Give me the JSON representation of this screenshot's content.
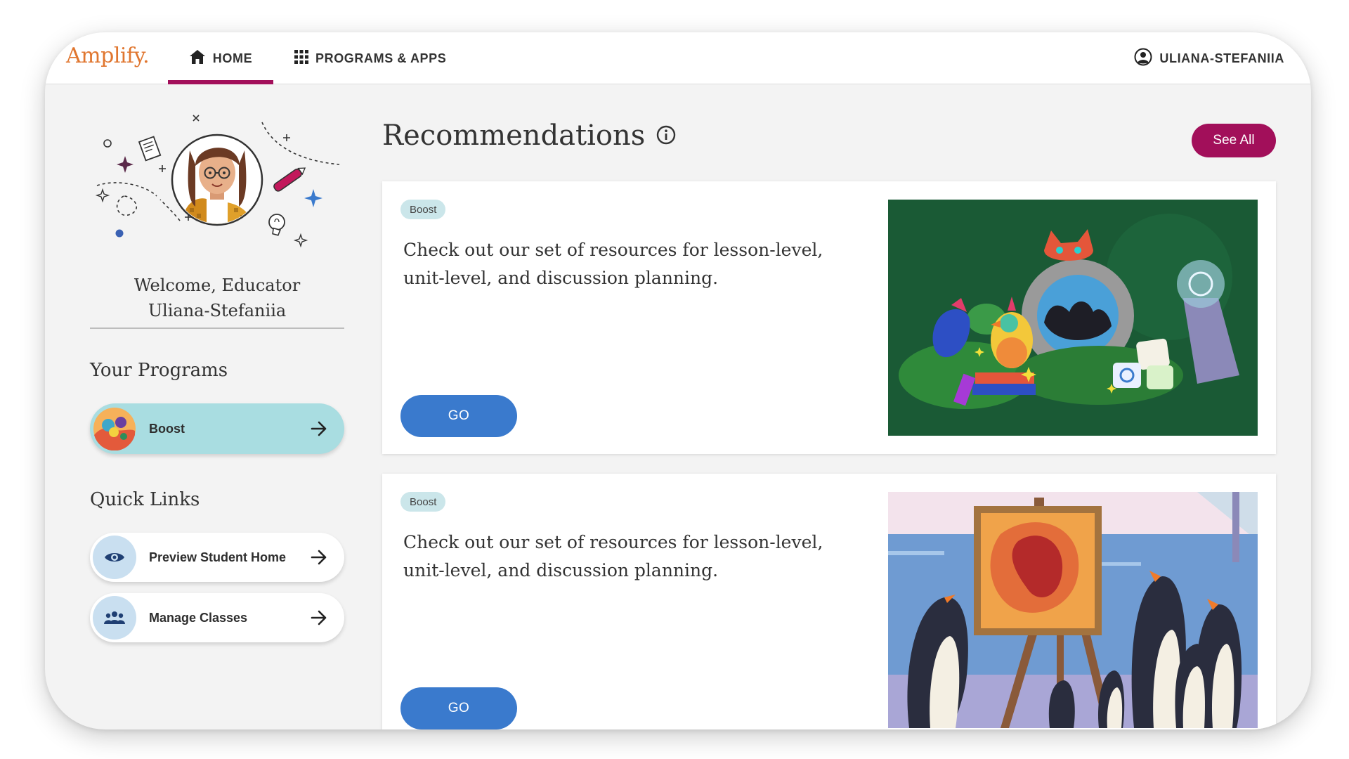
{
  "app": {
    "logo": "Amplify."
  },
  "nav": {
    "home_label": "HOME",
    "programs_label": "PROGRAMS & APPS",
    "user_name": "ULIANA-STEFANIIA"
  },
  "sidebar": {
    "welcome_line1": "Welcome, Educator",
    "welcome_line2": "Uliana-Stefaniia",
    "programs_title": "Your Programs",
    "programs": [
      {
        "label": "Boost",
        "icon": "boost-program-icon"
      }
    ],
    "quick_links_title": "Quick Links",
    "quick_links": [
      {
        "label": "Preview Student Home",
        "icon": "eye-icon"
      },
      {
        "label": "Manage Classes",
        "icon": "people-icon"
      }
    ]
  },
  "main": {
    "title": "Recommendations",
    "see_all_label": "See All",
    "cards": [
      {
        "badge": "Boost",
        "description": "Check out our set of resources for lesson-level, unit-level, and discussion planning.",
        "button": "GO",
        "image": "boost-characters-illustration"
      },
      {
        "badge": "Boost",
        "description": "Check out our set of resources for lesson-level, unit-level, and discussion planning.",
        "button": "GO",
        "image": "penguins-easel-illustration"
      }
    ]
  },
  "colors": {
    "brand_orange": "#e0762f",
    "accent_magenta": "#a20f5a",
    "go_blue": "#3a7acd",
    "program_card": "#a9dde1",
    "badge_bg": "#cbe6ea"
  }
}
